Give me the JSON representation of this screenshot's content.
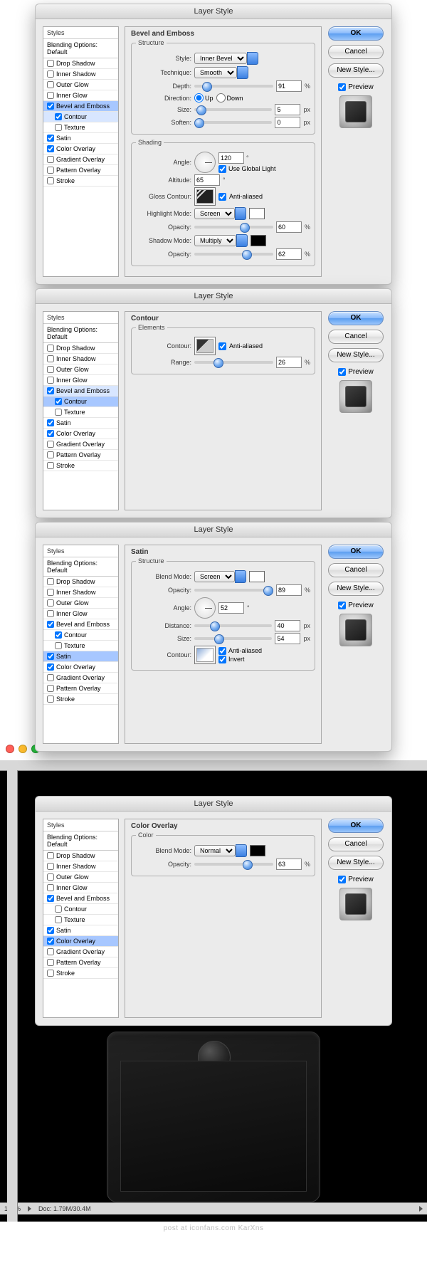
{
  "dialog_title": "Layer Style",
  "sidebar": {
    "styles_label": "Styles",
    "blending_label": "Blending Options: Default",
    "items": {
      "drop_shadow": "Drop Shadow",
      "inner_shadow": "Inner Shadow",
      "outer_glow": "Outer Glow",
      "inner_glow": "Inner Glow",
      "bevel_emboss": "Bevel and Emboss",
      "contour": "Contour",
      "texture": "Texture",
      "satin": "Satin",
      "color_overlay": "Color Overlay",
      "gradient_overlay": "Gradient Overlay",
      "pattern_overlay": "Pattern Overlay",
      "stroke": "Stroke"
    }
  },
  "buttons": {
    "ok": "OK",
    "cancel": "Cancel",
    "new_style": "New Style...",
    "preview": "Preview"
  },
  "labels": {
    "style": "Style:",
    "technique": "Technique:",
    "depth": "Depth:",
    "direction": "Direction:",
    "up": "Up",
    "down": "Down",
    "size": "Size:",
    "soften": "Soften:",
    "angle": "Angle:",
    "use_global": "Use Global Light",
    "altitude": "Altitude:",
    "gloss_contour": "Gloss Contour:",
    "anti_aliased": "Anti-aliased",
    "highlight_mode": "Highlight Mode:",
    "shadow_mode": "Shadow Mode:",
    "opacity": "Opacity:",
    "contour": "Contour:",
    "range": "Range:",
    "blend_mode": "Blend Mode:",
    "distance": "Distance:",
    "invert": "Invert",
    "percent": "%",
    "px": "px",
    "degree": "°"
  },
  "legends": {
    "structure": "Structure",
    "shading": "Shading",
    "elements": "Elements",
    "color": "Color"
  },
  "panels": {
    "bevel": {
      "title": "Bevel and Emboss",
      "style": "Inner Bevel",
      "technique": "Smooth",
      "depth": "91",
      "direction": "up",
      "size": "5",
      "soften": "0",
      "angle": "120",
      "use_global": true,
      "altitude": "65",
      "anti_aliased": true,
      "highlight_mode": "Screen",
      "highlight_opacity": "60",
      "shadow_mode": "Multiply",
      "shadow_opacity": "62"
    },
    "contour": {
      "title": "Contour",
      "anti_aliased": true,
      "range": "26"
    },
    "satin": {
      "title": "Satin",
      "blend_mode": "Screen",
      "opacity": "89",
      "angle": "52",
      "distance": "40",
      "size": "54",
      "anti_aliased": true,
      "invert": true
    },
    "color_overlay": {
      "title": "Color Overlay",
      "blend_mode": "Normal",
      "opacity": "63"
    }
  },
  "statusbar": {
    "zoom": "100%",
    "doc": "Doc: 1.79M/30.4M"
  },
  "watermark": "post at iconfans.com KarXns"
}
